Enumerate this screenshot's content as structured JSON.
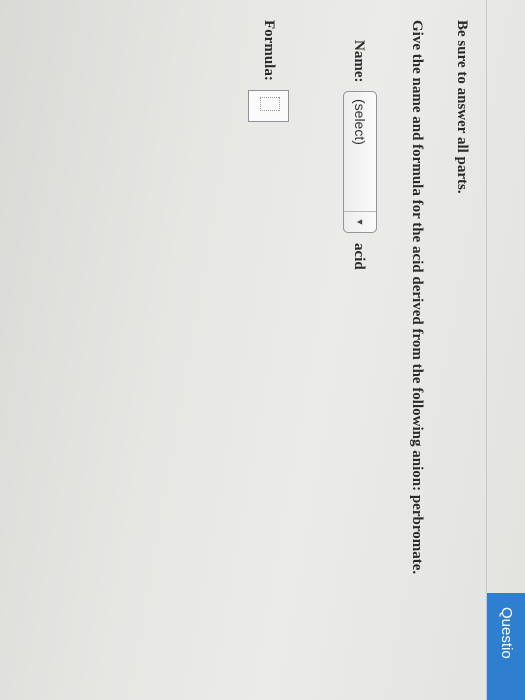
{
  "header": {
    "tab_label": "Questio"
  },
  "question": {
    "instruction": "Be sure to answer all parts.",
    "prompt": "Give the name and formula for the acid derived from the following anion: perbromate."
  },
  "name_field": {
    "label": "Name:",
    "selected_value": "(select)",
    "suffix": "acid",
    "dropdown_icon": "triangle-down-icon"
  },
  "formula_field": {
    "label": "Formula:",
    "value": ""
  },
  "colors": {
    "tab_background": "#2f7fd0",
    "text": "#2a2a2a"
  }
}
